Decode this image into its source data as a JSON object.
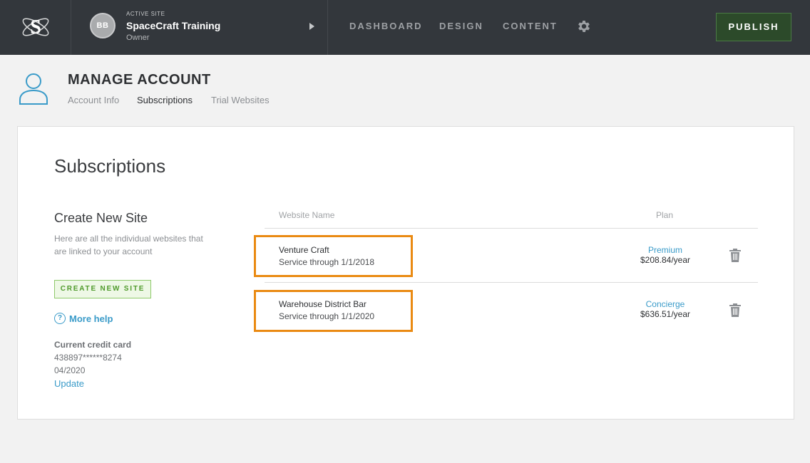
{
  "topbar": {
    "active_site_label": "ACTIVE SITE",
    "avatar_initials": "BB",
    "site_name": "SpaceCraft Training",
    "site_role": "Owner",
    "nav": [
      "DASHBOARD",
      "DESIGN",
      "CONTENT"
    ],
    "publish_label": "PUBLISH"
  },
  "header": {
    "title": "MANAGE ACCOUNT",
    "tabs": [
      {
        "label": "Account Info",
        "active": false
      },
      {
        "label": "Subscriptions",
        "active": true
      },
      {
        "label": "Trial Websites",
        "active": false
      }
    ]
  },
  "panel": {
    "title": "Subscriptions",
    "create_title": "Create New Site",
    "create_desc": "Here are all the individual websites that are linked to your account",
    "create_button": "CREATE NEW SITE",
    "help_icon": "?",
    "help_text": "More help",
    "credit_card": {
      "label": "Current credit card",
      "number": "438897******8274",
      "expiry": "04/2020",
      "update_label": "Update"
    }
  },
  "table": {
    "headers": [
      "Website Name",
      "Plan"
    ],
    "rows": [
      {
        "name": "Venture Craft",
        "service": "Service through 1/1/2018",
        "plan": "Premium",
        "price": "$208.84/year"
      },
      {
        "name": "Warehouse District Bar",
        "service": "Service through 1/1/2020",
        "plan": "Concierge",
        "price": "$636.51/year"
      }
    ]
  },
  "colors": {
    "topbar_bg": "#33373c",
    "publish_bg": "#2c4a2a",
    "link_blue": "#3a9bc9",
    "create_green": "#4f9a2b",
    "highlight_orange": "#ea8a12"
  },
  "icons": [
    "spacecraft-logo-icon",
    "play-icon",
    "gear-icon",
    "user-icon",
    "help-icon",
    "trash-icon"
  ]
}
